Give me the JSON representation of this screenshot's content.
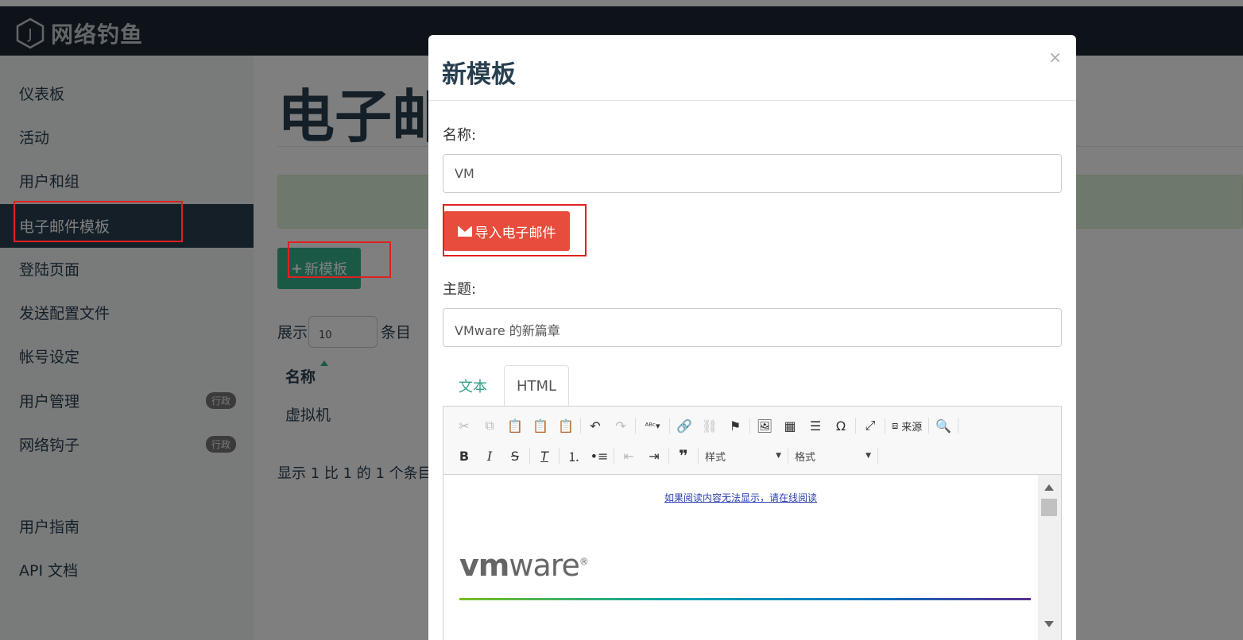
{
  "brand": {
    "name": "网络钓鱼",
    "logo_letter": "J"
  },
  "sidebar": {
    "items": [
      {
        "label": "仪表板"
      },
      {
        "label": "活动"
      },
      {
        "label": "用户和组"
      },
      {
        "label": "电子邮件模板",
        "active": true
      },
      {
        "label": "登陆页面"
      },
      {
        "label": "发送配置文件"
      },
      {
        "label": "帐号设定"
      },
      {
        "label": "用户管理",
        "badge": "行政"
      },
      {
        "label": "网络钩子",
        "badge": "行政"
      },
      {
        "label": "用户指南"
      },
      {
        "label": "API 文档"
      }
    ]
  },
  "main": {
    "title": "电子邮件模板",
    "new_button": "新模板",
    "show_prefix": "展示",
    "show_value": "10",
    "show_suffix": "条目",
    "column_name": "名称",
    "rows": [
      {
        "name": "虚拟机"
      }
    ],
    "info": "显示 1 比 1 的 1 个条目"
  },
  "modal": {
    "title": "新模板",
    "close": "×",
    "name_label": "名称:",
    "name_value": "VM",
    "import_button": "导入电子邮件",
    "subject_label": "主题:",
    "subject_value": "VMware 的新篇章",
    "tabs": [
      {
        "label": "文本"
      },
      {
        "label": "HTML",
        "active": true
      }
    ],
    "toolbar": {
      "source_label": "来源",
      "style_combo": "样式",
      "format_combo": "格式"
    },
    "content": {
      "link_text": "如果阅读内容无法显示，请在线阅读",
      "logo_vm": "vm",
      "logo_ware": "ware",
      "logo_mark": "®"
    }
  },
  "colors": {
    "navbar": "#1b2733",
    "sidebar_active": "#283f50",
    "primary_green": "#37b28e",
    "danger_red": "#e74c3c",
    "annotation_red": "#e02020"
  }
}
